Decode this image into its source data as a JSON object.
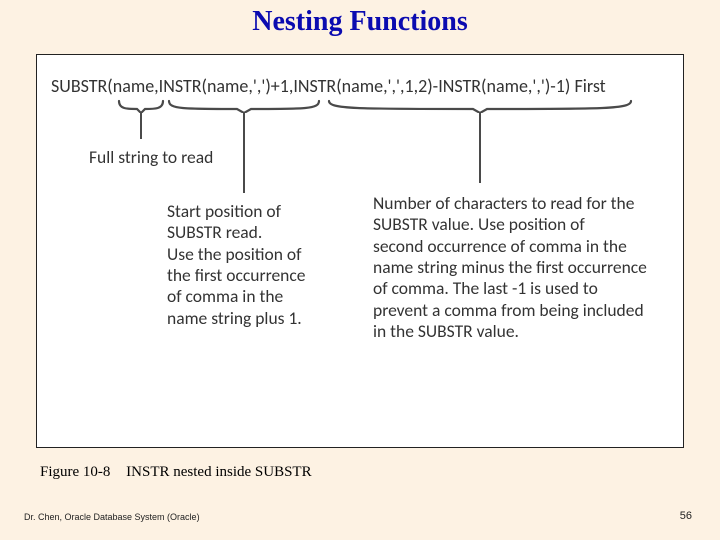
{
  "title": "Nesting Functions",
  "code": "SUBSTR(name,INSTR(name,',')+1,INSTR(name,',',1,2)-INSTR(name,',')-1) First",
  "explain": {
    "a": "Full string to read",
    "b": "Start position of\nSUBSTR read.\nUse the position of\nthe first occurrence\nof comma in the\nname string plus 1.",
    "c": "Number of characters to read for the\nSUBSTR value.  Use position of\nsecond occurrence of comma in the\nname string minus the first occurrence\nof comma.  The last -1 is used to\nprevent a comma from being included\nin the SUBSTR value."
  },
  "caption_figure": "Figure 10-8",
  "caption_text": "INSTR nested inside SUBSTR",
  "footer_left": "Dr. Chen, Oracle Database System (Oracle)",
  "footer_right": "56"
}
